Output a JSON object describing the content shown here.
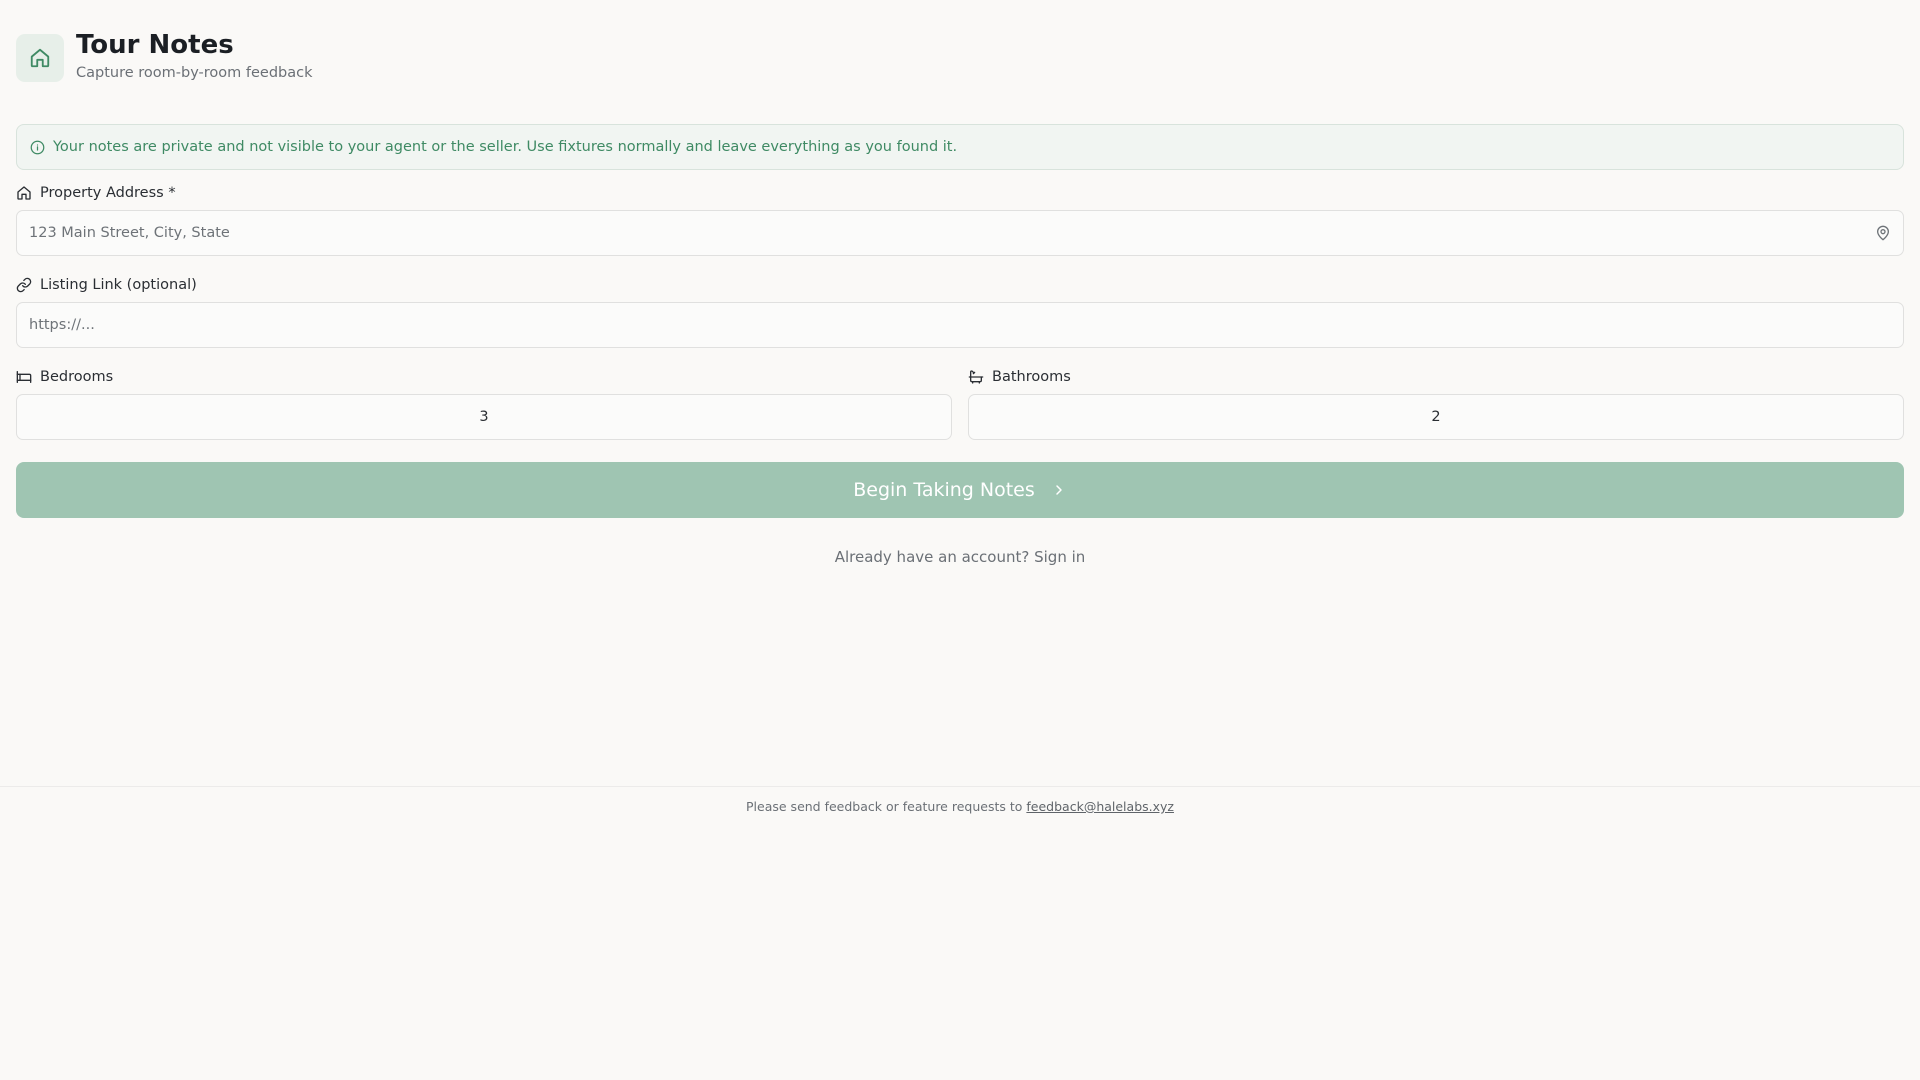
{
  "header": {
    "title": "Tour Notes",
    "subtitle": "Capture room-by-room feedback",
    "logo_icon": "home-icon"
  },
  "banner": {
    "icon": "info-icon",
    "text": "Your notes are private and not visible to your agent or the seller. Use fixtures normally and leave everything as you found it."
  },
  "form": {
    "address": {
      "label": "Property Address *",
      "icon": "home-icon",
      "placeholder": "123 Main Street, City, State",
      "value": "",
      "trailing_icon": "map-pin-icon"
    },
    "listing": {
      "label": "Listing Link (optional)",
      "icon": "link-icon",
      "placeholder": "https://...",
      "value": ""
    },
    "bedrooms": {
      "label": "Bedrooms",
      "icon": "bed-icon",
      "value": "3"
    },
    "bathrooms": {
      "label": "Bathrooms",
      "icon": "bath-icon",
      "value": "2"
    }
  },
  "actions": {
    "begin_label": "Begin Taking Notes",
    "begin_icon": "chevron-right-icon",
    "signin_prompt": "Already have an account?",
    "signin_link": "Sign in"
  },
  "footer": {
    "text": "Please send feedback or feature requests to",
    "email": "feedback@halelabs.xyz"
  },
  "colors": {
    "accent": "#3f8a64",
    "button": "#9fc5b2",
    "background": "#faf9f7",
    "banner_bg": "#f1f5f2"
  }
}
